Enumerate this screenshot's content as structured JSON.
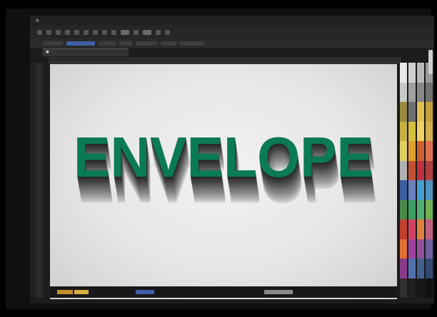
{
  "artwork": {
    "text": "ENVELOPE",
    "fill_color": "#0b7a56",
    "shadow_color": "#1a1a1a"
  },
  "colors": {
    "window_bg": "#1c1c1c",
    "canvas_light": "#f2f2f2",
    "accent_blue": "#3f5fa8"
  },
  "palette": {
    "column_1": [
      "#e8e8e8",
      "#c9c9c9",
      "#9a8a3a",
      "#c8b040",
      "#e0d060",
      "#b0b0b0",
      "#3a5fa0",
      "#4a8a4a",
      "#c04030",
      "#e07030",
      "#8a3a8a",
      "#303030"
    ],
    "column_2": [
      "#d0d0d0",
      "#a0a0a0",
      "#707070",
      "#d8c040",
      "#e0a030",
      "#c05030",
      "#6a80c0",
      "#3aa060",
      "#d04060",
      "#a040a0",
      "#5070b0",
      "#202020"
    ],
    "column_3": [
      "#b8b8b8",
      "#888888",
      "#e0c050",
      "#f0d060",
      "#d06030",
      "#c03040",
      "#40a0d0",
      "#50b070",
      "#e08040",
      "#9050a0",
      "#406090",
      "#181818"
    ],
    "column_4": [
      "#9a9a9a",
      "#707070",
      "#c0a040",
      "#d0b050",
      "#e07050",
      "#b04040",
      "#5090c0",
      "#70b050",
      "#c06080",
      "#7060a0",
      "#304870",
      "#101010"
    ]
  },
  "bottom_swatches": [
    "#c09030",
    "#d8b040",
    "#3f5fa8",
    "#8a8a8a"
  ]
}
